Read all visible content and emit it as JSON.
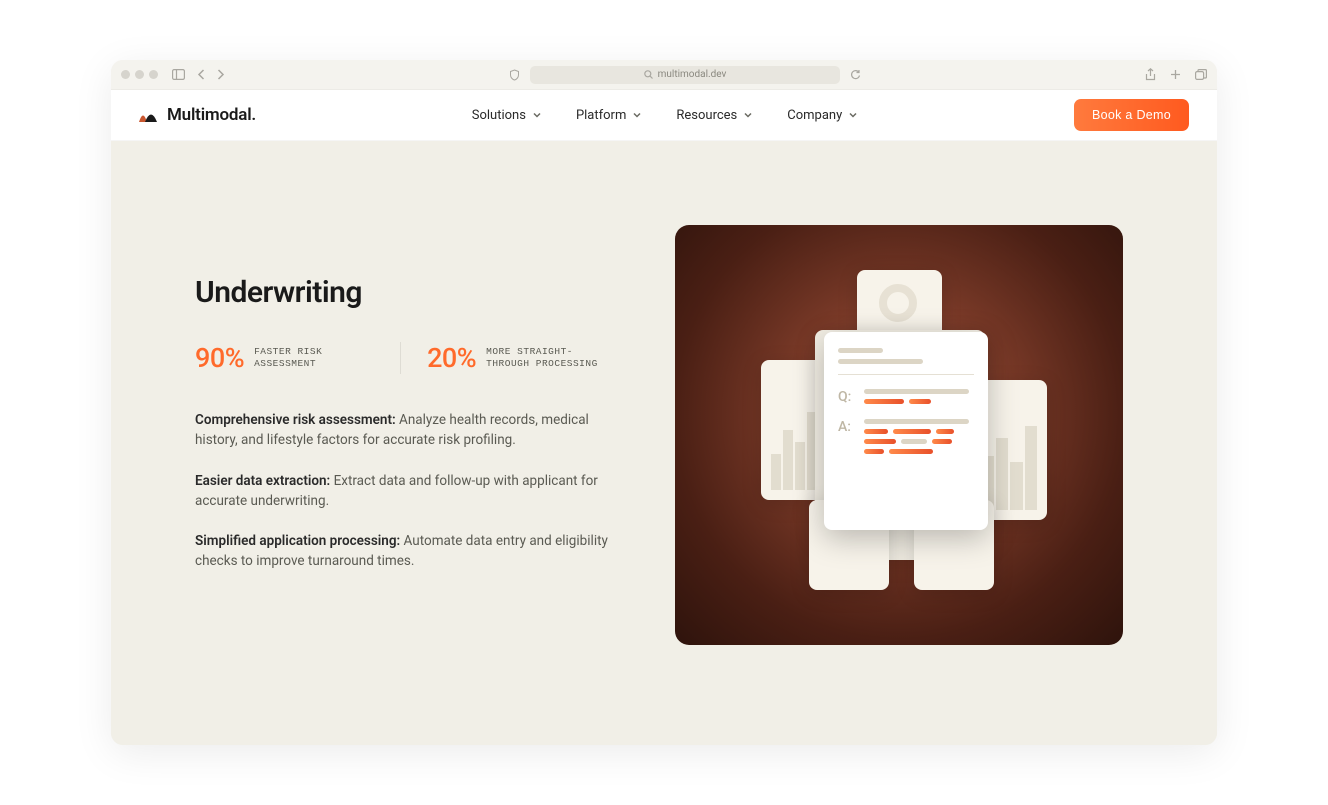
{
  "browser": {
    "url": "multimodal.dev"
  },
  "brand": {
    "name": "Multimodal."
  },
  "nav": {
    "items": [
      {
        "label": "Solutions"
      },
      {
        "label": "Platform"
      },
      {
        "label": "Resources"
      },
      {
        "label": "Company"
      }
    ],
    "cta": "Book a Demo"
  },
  "content": {
    "title": "Underwriting",
    "stats": [
      {
        "value": "90%",
        "label": "FASTER RISK ASSESSMENT"
      },
      {
        "value": "20%",
        "label": "MORE STRAIGHT-THROUGH PROCESSING"
      }
    ],
    "features": [
      {
        "bold": "Comprehensive risk assessment:",
        "text": " Analyze health records, medical history, and lifestyle factors for accurate risk profiling."
      },
      {
        "bold": "Easier data extraction:",
        "text": " Extract data and follow-up with applicant for accurate underwriting."
      },
      {
        "bold": "Simplified application processing:",
        "text": " Automate data entry and eligibility checks to improve turnaround times."
      }
    ],
    "qa": {
      "q": "Q:",
      "a": "A:"
    }
  }
}
